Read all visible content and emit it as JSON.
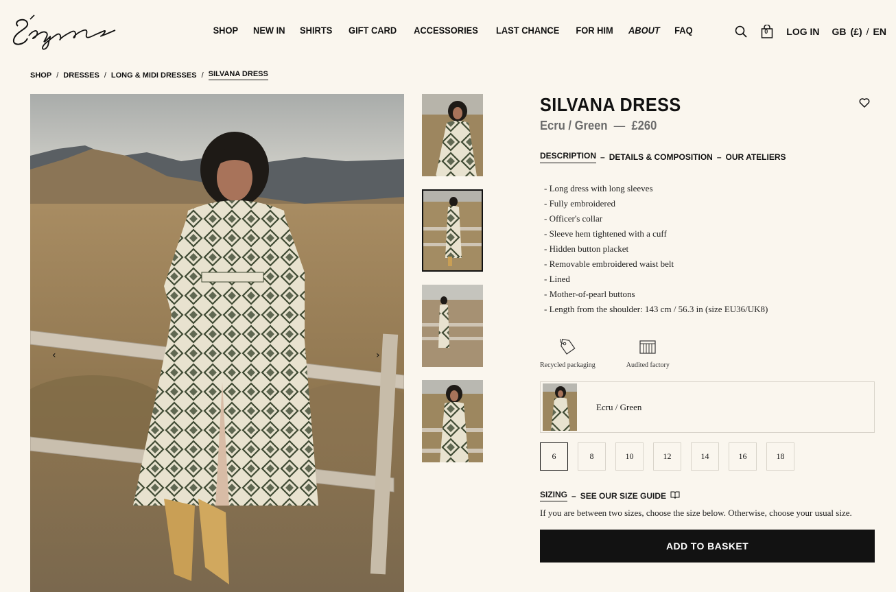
{
  "brand": {
    "logo_text": "Sézane"
  },
  "nav": {
    "items": [
      {
        "label": "SHOP"
      },
      {
        "label": "NEW IN"
      },
      {
        "label": "SHIRTS"
      },
      {
        "label": "GIFT CARD"
      },
      {
        "label": "ACCESSORIES"
      },
      {
        "label": "LAST CHANCE"
      },
      {
        "label": "FOR HIM"
      },
      {
        "label": "ABOUT"
      },
      {
        "label": "FAQ"
      }
    ]
  },
  "header": {
    "basket_count": "0",
    "login_label": "LOG IN",
    "country": "GB",
    "currency": "(£)",
    "lang_sep": "/",
    "language": "EN"
  },
  "breadcrumb": {
    "items": [
      "SHOP",
      "DRESSES",
      "LONG & MIDI DRESSES"
    ],
    "current": "SILVANA DRESS",
    "sep": "/"
  },
  "gallery": {
    "prev": "‹",
    "next": "›"
  },
  "product": {
    "title": "SILVANA DRESS",
    "color": "Ecru / Green",
    "dash": "—",
    "price": "£260",
    "tabs": {
      "description": "DESCRIPTION",
      "sep1": "–",
      "details": "DETAILS & COMPOSITION",
      "sep2": "–",
      "ateliers": "OUR ATELIERS"
    },
    "description": [
      "- Long dress with long sleeves",
      "- Fully embroidered",
      "- Officer's collar",
      "- Sleeve hem tightened with a cuff",
      "- Hidden button placket",
      "- Removable embroidered waist belt",
      "- Lined",
      "- Mother-of-pearl buttons",
      "- Length from the shoulder: 143 cm / 56.3 in (size EU36/UK8)"
    ],
    "badges": {
      "recycled": "Recycled packaging",
      "audited": "Audited factory"
    },
    "variant_label": "Ecru / Green",
    "sizes": [
      "6",
      "8",
      "10",
      "12",
      "14",
      "16",
      "18"
    ],
    "selected_size": "6",
    "sizing": {
      "label": "SIZING",
      "dash": "–",
      "guide": "SEE OUR SIZE GUIDE",
      "help": "If you are between two sizes, choose the size below. Otherwise, choose your usual size."
    },
    "add_to_basket": "ADD TO BASKET"
  },
  "colors": {
    "background": "#faf6ee",
    "text": "#111111",
    "muted": "#6b6b6b",
    "button": "#121212",
    "dress_green": "#3f4a33",
    "dress_ecru": "#e8e2cf"
  }
}
